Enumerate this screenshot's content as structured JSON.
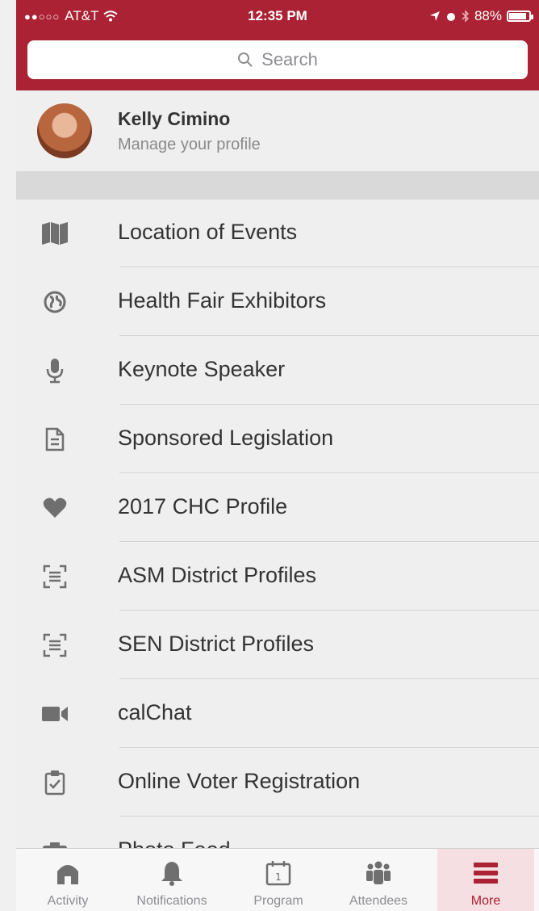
{
  "status": {
    "carrier": "AT&T",
    "signal": "●●○○○",
    "time": "12:35 PM",
    "battery": "88%",
    "battery_level": 0.88
  },
  "search": {
    "placeholder": "Search"
  },
  "profile": {
    "name": "Kelly Cimino",
    "subtitle": "Manage your profile"
  },
  "menu": {
    "items": [
      {
        "label": "Location of Events",
        "icon": "map-icon"
      },
      {
        "label": "Health Fair Exhibitors",
        "icon": "globe-icon"
      },
      {
        "label": "Keynote Speaker",
        "icon": "microphone-icon"
      },
      {
        "label": "Sponsored Legislation",
        "icon": "document-icon"
      },
      {
        "label": "2017 CHC Profile",
        "icon": "heart-icon"
      },
      {
        "label": "ASM District Profiles",
        "icon": "scan-text-icon"
      },
      {
        "label": "SEN District Profiles",
        "icon": "scan-text-icon"
      },
      {
        "label": "calChat",
        "icon": "video-camera-icon"
      },
      {
        "label": "Online Voter Registration",
        "icon": "clipboard-check-icon"
      },
      {
        "label": "Photo Feed",
        "icon": "camera-icon"
      }
    ]
  },
  "tabs": [
    {
      "label": "Activity",
      "icon": "home-icon"
    },
    {
      "label": "Notifications",
      "icon": "bell-icon"
    },
    {
      "label": "Program",
      "icon": "calendar-icon",
      "day": "1"
    },
    {
      "label": "Attendees",
      "icon": "people-icon"
    },
    {
      "label": "More",
      "icon": "menu-icon"
    }
  ],
  "colors": {
    "brand": "#aa2233",
    "active_tab_bg": "#f6dfe2",
    "icon_gray": "#6f6f6f"
  }
}
